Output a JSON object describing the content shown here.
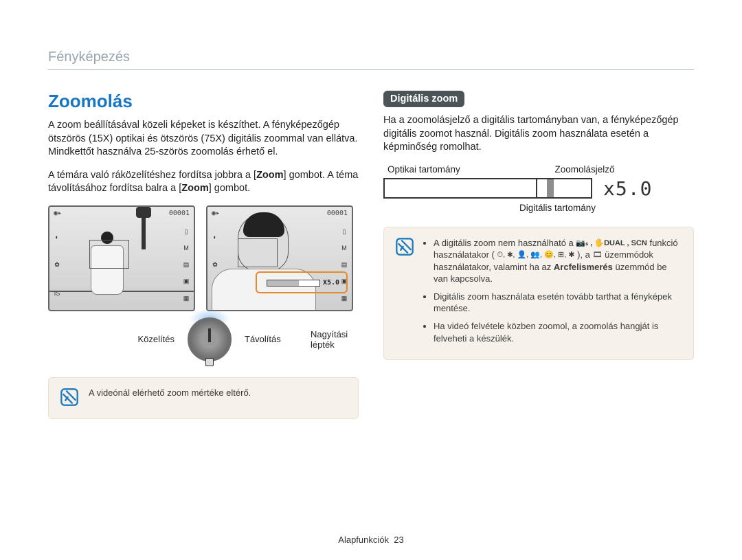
{
  "breadcrumb": "Fényképezés",
  "left": {
    "title": "Zoomolás",
    "p1": "A zoom beállításával közeli képeket is készíthet. A fényképezőgép ötszörös (15X) optikai és ötszörös (75X) digitális zoommal van ellátva. Mindkettőt használva 25-szörös zoomolás érhető el.",
    "p2a": "A témára való ráközelítéshez fordítsa jobbra a [",
    "p2b": "] gombot. A téma távolításához fordítsa balra a [",
    "p2c": "] gombot.",
    "zoom_word": "Zoom",
    "previewCounter": "00001",
    "zoomBarInPreview": "X5.0",
    "belowLabels": {
      "closer": "Közelítés",
      "farther": "Távolítás",
      "scale": "Nagyítási lépték"
    },
    "note": "A videónál elérhető zoom mértéke eltérő."
  },
  "right": {
    "pill": "Digitális zoom",
    "p1": "Ha a zoomolásjelző a digitális tartományban van, a fényképezőgép digitális zoomot használ. Digitális zoom használata esetén a képminőség romolhat.",
    "diagram": {
      "optical": "Optikai tartomány",
      "indicator": "Zoomolásjelző",
      "digital": "Digitális tartomány",
      "value": "x5.0"
    },
    "notes": {
      "n1a": "A digitális zoom nem használható a ",
      "n1b": " funkció használatakor ( ",
      "n1c": " ), a ",
      "n1d": " üzemmódok használatakor, valamint ha az ",
      "n1e": " üzemmód be van kapcsolva.",
      "arcfel": "Arcfelismerés",
      "funcIcons": "📷ₛ , 🖐DUAL , SCN",
      "modeIcons": "⏱, ✱, 👤, 👥, 😊, ⊞, ✱",
      "movieIcon": "🎞",
      "n2": "Digitális zoom használata esetén tovább tarthat a fényképek mentése.",
      "n3": "Ha videó felvétele közben zoomol, a zoomolás hangját is felveheti a készülék."
    }
  },
  "footer": {
    "section": "Alapfunkciók",
    "page": "23"
  }
}
